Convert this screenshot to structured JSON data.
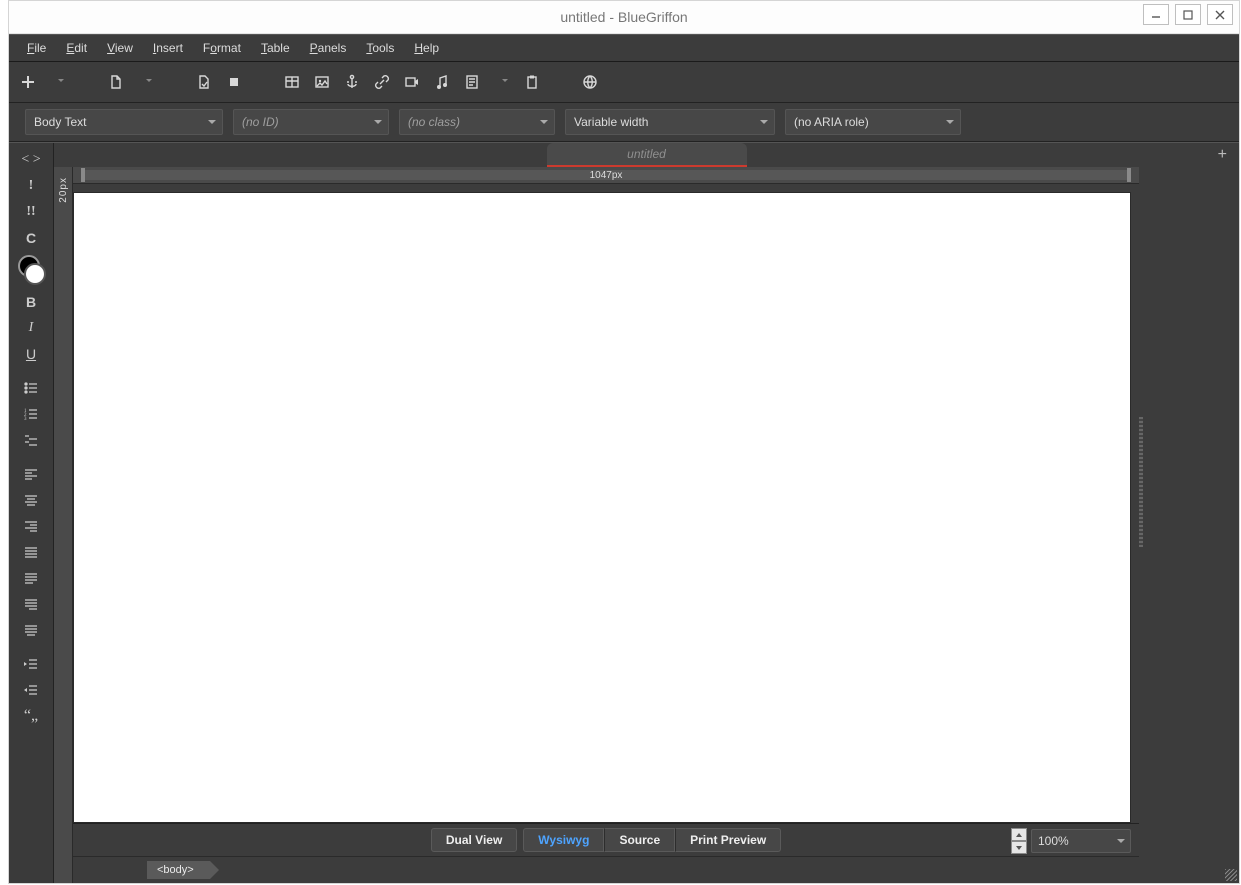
{
  "window": {
    "title": "untitled - BlueGriffon"
  },
  "menus": [
    {
      "label": "File",
      "u": "F"
    },
    {
      "label": "Edit",
      "u": "E"
    },
    {
      "label": "View",
      "u": "V"
    },
    {
      "label": "Insert",
      "u": "I"
    },
    {
      "label": "Format",
      "u": "o"
    },
    {
      "label": "Table",
      "u": "T"
    },
    {
      "label": "Panels",
      "u": "P"
    },
    {
      "label": "Tools",
      "u": "T"
    },
    {
      "label": "Help",
      "u": "H"
    }
  ],
  "selectors": {
    "element": "Body Text",
    "id_placeholder": "(no ID)",
    "class_placeholder": "(no class)",
    "font": "Variable width",
    "aria": "(no ARIA role)"
  },
  "document_tab": "untitled",
  "ruler": {
    "width_label": "1047px",
    "vlabel": "20px"
  },
  "views": {
    "dual": "Dual View",
    "wysiwyg": "Wysiwyg",
    "source": "Source",
    "print": "Print Preview"
  },
  "zoom": "100%",
  "breadcrumb": "<body>"
}
